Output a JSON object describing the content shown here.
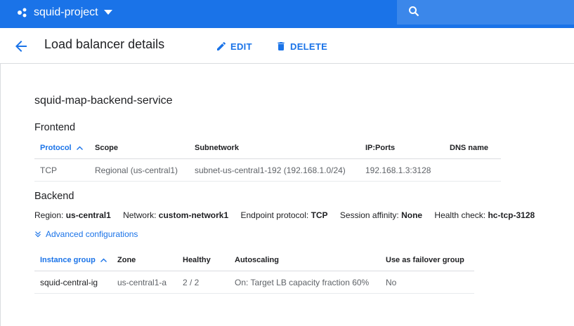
{
  "topbar": {
    "project_name": "squid-project"
  },
  "header": {
    "title": "Load balancer details",
    "edit_label": "EDIT",
    "delete_label": "DELETE"
  },
  "service_name": "squid-map-backend-service",
  "frontend": {
    "heading": "Frontend",
    "columns": [
      "Protocol",
      "Scope",
      "Subnetwork",
      "IP:Ports",
      "DNS name"
    ],
    "rows": [
      [
        "TCP",
        "Regional (us-central1)",
        "subnet-us-central1-192 (192.168.1.0/24)",
        "192.168.1.3:3128",
        ""
      ]
    ]
  },
  "backend": {
    "heading": "Backend",
    "region_label": "Region:",
    "region": "us-central1",
    "network_label": "Network:",
    "network": "custom-network1",
    "protocol_label": "Endpoint protocol:",
    "protocol": "TCP",
    "affinity_label": "Session affinity:",
    "affinity": "None",
    "health_label": "Health check:",
    "health": "hc-tcp-3128",
    "advanced_label": "Advanced configurations",
    "columns": [
      "Instance group",
      "Zone",
      "Healthy",
      "Autoscaling",
      "Use as failover group"
    ],
    "rows": [
      [
        "squid-central-ig",
        "us-central1-a",
        "2 / 2",
        "On: Target LB capacity fraction 60%",
        "No"
      ]
    ]
  }
}
